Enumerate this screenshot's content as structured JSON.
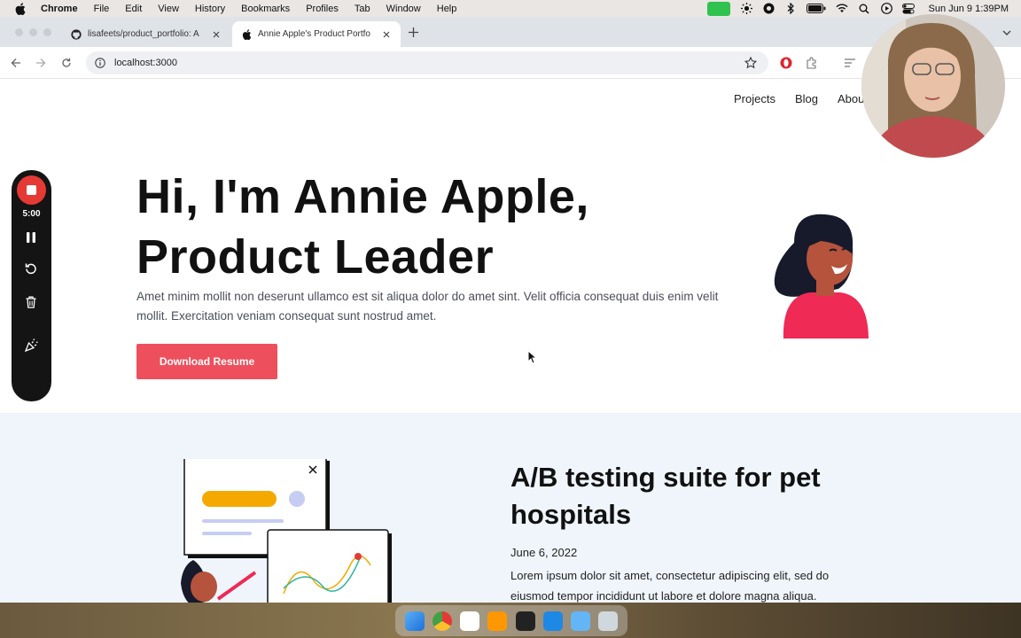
{
  "menubar": {
    "app_name": "Chrome",
    "items": [
      "File",
      "Edit",
      "View",
      "History",
      "Bookmarks",
      "Profiles",
      "Tab",
      "Window",
      "Help"
    ],
    "clock": "Sun Jun 9  1:39PM"
  },
  "browser": {
    "tabs": [
      {
        "title": "lisafeets/product_portfolio: A",
        "icon": "github-icon",
        "active": false
      },
      {
        "title": "Annie Apple's Product Portfo",
        "icon": "apple-icon",
        "active": true
      }
    ],
    "url": "localhost:3000"
  },
  "page": {
    "nav": [
      "Projects",
      "Blog",
      "About"
    ],
    "hero": {
      "title_line1": "Hi, I'm Annie Apple,",
      "title_line2": "Product Leader",
      "text": "Amet minim mollit non deserunt ullamco est sit aliqua dolor do amet sint. Velit officia consequat duis enim velit mollit. Exercitation veniam consequat sunt nostrud amet.",
      "button": "Download Resume"
    },
    "project": {
      "title": "A/B testing suite for pet hospitals",
      "date": "June 6, 2022",
      "text": "Lorem ipsum dolor sit amet, consectetur adipiscing elit, sed do eiusmod tempor incididunt ut labore et dolore magna aliqua."
    }
  },
  "recorder": {
    "timer": "5:00"
  },
  "colors": {
    "accent": "#ee4f5c",
    "section_bg": "#f0f5fc",
    "record_red": "#e53935"
  }
}
